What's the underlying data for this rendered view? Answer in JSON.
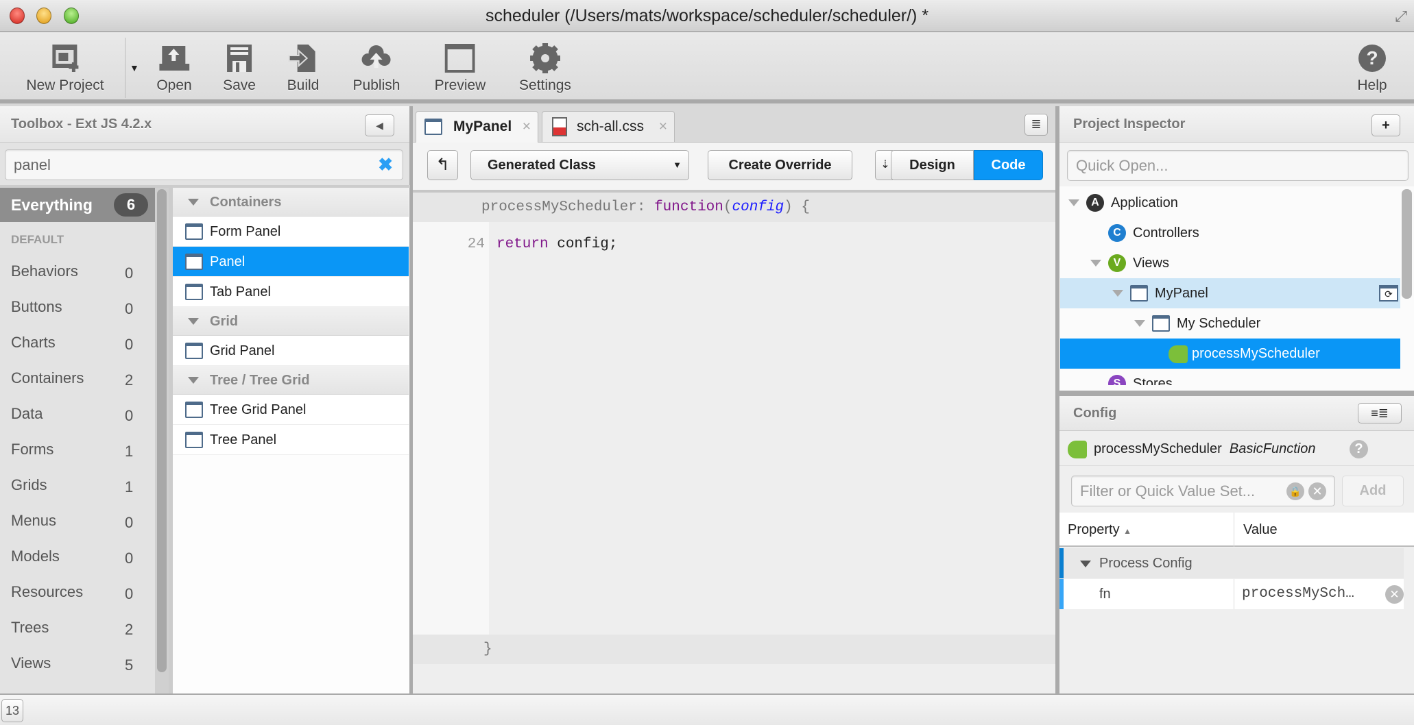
{
  "window": {
    "title": "scheduler (/Users/mats/workspace/scheduler/scheduler/) *"
  },
  "toolbar": {
    "new_project": "New Project",
    "open": "Open",
    "save": "Save",
    "build": "Build",
    "publish": "Publish",
    "preview": "Preview",
    "settings": "Settings",
    "help": "Help"
  },
  "toolbox": {
    "title": "Toolbox - Ext JS 4.2.x",
    "search_value": "panel",
    "everything": {
      "label": "Everything",
      "count": "6"
    },
    "section": "DEFAULT",
    "categories": [
      {
        "label": "Behaviors",
        "count": "0"
      },
      {
        "label": "Buttons",
        "count": "0"
      },
      {
        "label": "Charts",
        "count": "0"
      },
      {
        "label": "Containers",
        "count": "2"
      },
      {
        "label": "Data",
        "count": "0"
      },
      {
        "label": "Forms",
        "count": "1"
      },
      {
        "label": "Grids",
        "count": "1"
      },
      {
        "label": "Menus",
        "count": "0"
      },
      {
        "label": "Models",
        "count": "0"
      },
      {
        "label": "Resources",
        "count": "0"
      },
      {
        "label": "Trees",
        "count": "2"
      },
      {
        "label": "Views",
        "count": "5"
      }
    ],
    "groups": [
      {
        "label": "Containers",
        "items": [
          "Form Panel",
          "Panel",
          "Tab Panel"
        ]
      },
      {
        "label": "Grid",
        "items": [
          "Grid Panel"
        ]
      },
      {
        "label": "Tree / Tree Grid",
        "items": [
          "Tree Grid Panel",
          "Tree Panel"
        ]
      }
    ],
    "selected_item": "Panel"
  },
  "editor": {
    "tabs": [
      {
        "label": "MyPanel",
        "active": true
      },
      {
        "label": "sch-all.css",
        "active": false
      }
    ],
    "class_select": "Generated Class",
    "create_override": "Create Override",
    "design": "Design",
    "code": "Code",
    "mode": "Code",
    "header_name": "processMyScheduler:",
    "header_kw": "function",
    "header_paren_open": "(",
    "header_param": "config",
    "header_rest": ") {",
    "line_number": "24",
    "line_kw": "return",
    "line_rest": " config;",
    "closing": "}"
  },
  "inspector": {
    "title": "Project Inspector",
    "add": "+",
    "quick_open_placeholder": "Quick Open...",
    "tree": [
      {
        "label": "Application",
        "icon": "A"
      },
      {
        "label": "Controllers",
        "icon": "C"
      },
      {
        "label": "Views",
        "icon": "V"
      },
      {
        "label": "MyPanel"
      },
      {
        "label": "My Scheduler"
      },
      {
        "label": "processMyScheduler"
      },
      {
        "label": "Stores",
        "icon": "S"
      }
    ]
  },
  "config": {
    "title": "Config",
    "object_name": "processMyScheduler",
    "object_type": "BasicFunction",
    "filter_placeholder": "Filter or Quick Value Set...",
    "add": "Add",
    "col_property": "Property",
    "col_value": "Value",
    "group": "Process Config",
    "rows": [
      {
        "property": "fn",
        "value": "processMySch…"
      }
    ]
  },
  "status": {
    "count": "13"
  },
  "colors": {
    "selection": "#0a96f6",
    "hover_row": "#cde6f7"
  }
}
